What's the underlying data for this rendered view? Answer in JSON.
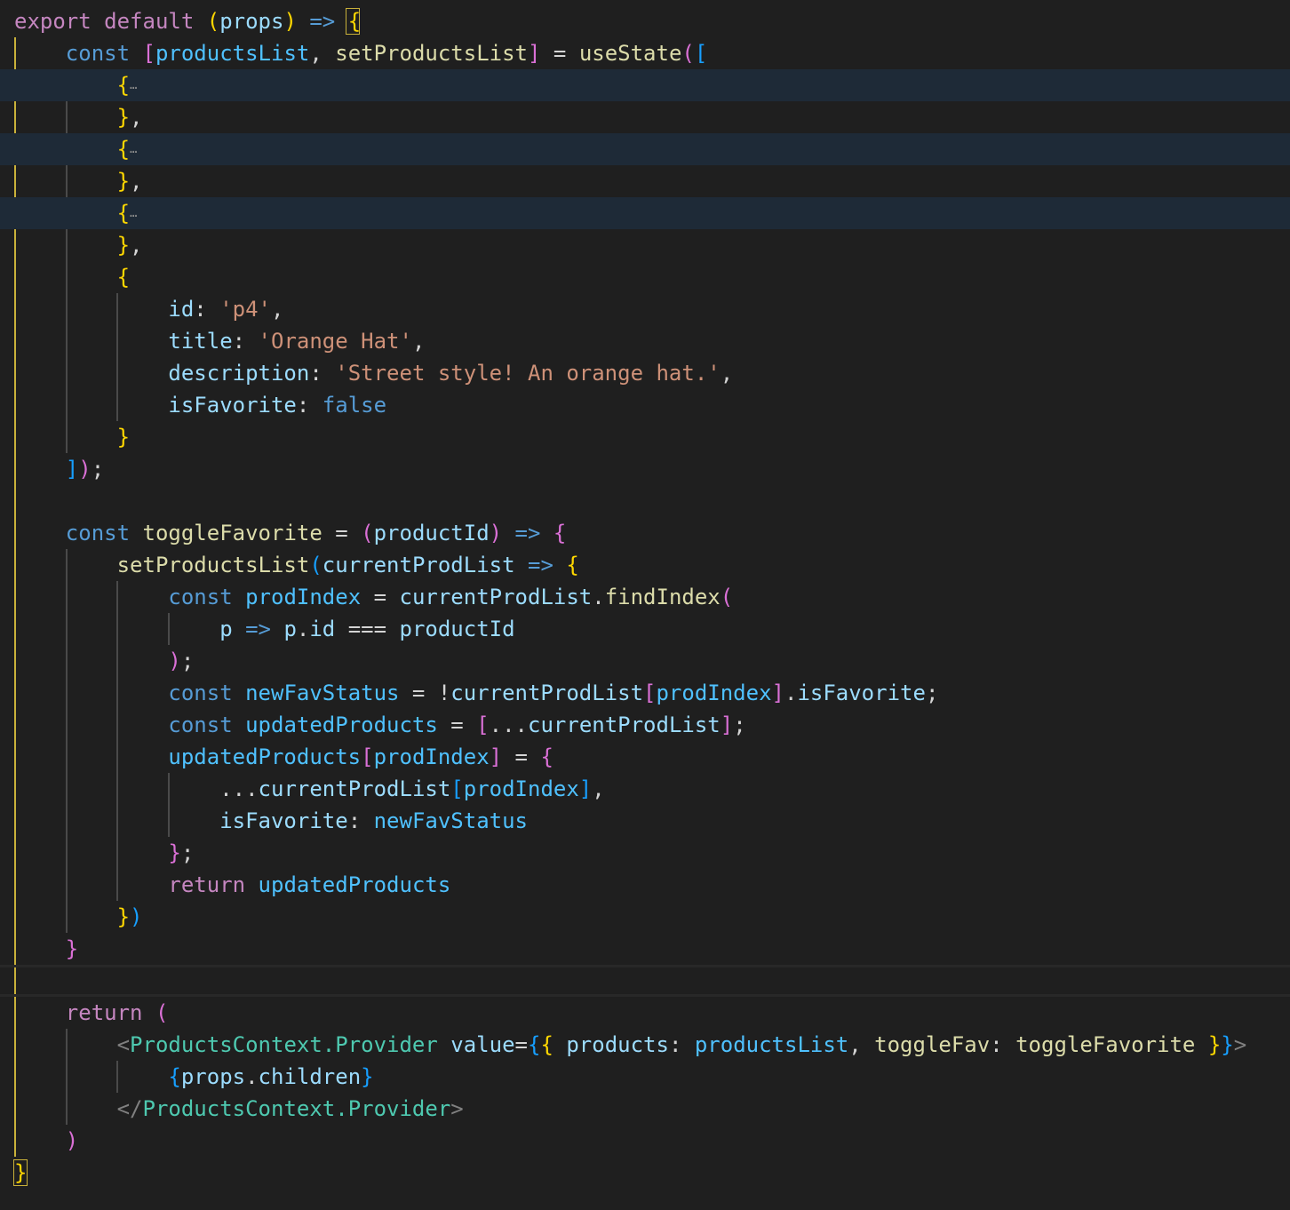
{
  "editor": {
    "lines": [
      [
        [
          "ctl",
          "export default "
        ],
        [
          "b1",
          "("
        ],
        [
          "prm",
          "props"
        ],
        [
          "b1",
          ")"
        ],
        [
          "kw",
          " => "
        ],
        [
          "b1",
          "{"
        ]
      ],
      [
        [
          "pun",
          "    "
        ],
        [
          "kw",
          "const "
        ],
        [
          "b2",
          "["
        ],
        [
          "var",
          "productsList"
        ],
        [
          "pun",
          ", "
        ],
        [
          "fn",
          "setProductsList"
        ],
        [
          "b2",
          "]"
        ],
        [
          "pun",
          " = "
        ],
        [
          "fn",
          "useState"
        ],
        [
          "b2",
          "("
        ],
        [
          "b3",
          "["
        ]
      ],
      [
        [
          "pun",
          "        "
        ],
        [
          "b1",
          "{"
        ],
        [
          "ell",
          "…"
        ]
      ],
      [
        [
          "pun",
          "        "
        ],
        [
          "b1",
          "}"
        ],
        [
          "pun",
          ","
        ]
      ],
      [
        [
          "pun",
          "        "
        ],
        [
          "b1",
          "{"
        ],
        [
          "ell",
          "…"
        ]
      ],
      [
        [
          "pun",
          "        "
        ],
        [
          "b1",
          "}"
        ],
        [
          "pun",
          ","
        ]
      ],
      [
        [
          "pun",
          "        "
        ],
        [
          "b1",
          "{"
        ],
        [
          "ell",
          "…"
        ]
      ],
      [
        [
          "pun",
          "        "
        ],
        [
          "b1",
          "}"
        ],
        [
          "pun",
          ","
        ]
      ],
      [
        [
          "pun",
          "        "
        ],
        [
          "b1",
          "{"
        ]
      ],
      [
        [
          "pun",
          "            "
        ],
        [
          "prm",
          "id"
        ],
        [
          "pun",
          ": "
        ],
        [
          "str",
          "'p4'"
        ],
        [
          "pun",
          ","
        ]
      ],
      [
        [
          "pun",
          "            "
        ],
        [
          "prm",
          "title"
        ],
        [
          "pun",
          ": "
        ],
        [
          "str",
          "'Orange Hat'"
        ],
        [
          "pun",
          ","
        ]
      ],
      [
        [
          "pun",
          "            "
        ],
        [
          "prm",
          "description"
        ],
        [
          "pun",
          ": "
        ],
        [
          "str",
          "'Street style! An orange hat.'"
        ],
        [
          "pun",
          ","
        ]
      ],
      [
        [
          "pun",
          "            "
        ],
        [
          "prm",
          "isFavorite"
        ],
        [
          "pun",
          ": "
        ],
        [
          "kw",
          "false"
        ]
      ],
      [
        [
          "pun",
          "        "
        ],
        [
          "b1",
          "}"
        ]
      ],
      [
        [
          "pun",
          "    "
        ],
        [
          "b3",
          "]"
        ],
        [
          "b2",
          ")"
        ],
        [
          "pun",
          ";"
        ]
      ],
      [],
      [
        [
          "pun",
          "    "
        ],
        [
          "kw",
          "const "
        ],
        [
          "fn",
          "toggleFavorite"
        ],
        [
          "pun",
          " = "
        ],
        [
          "b2",
          "("
        ],
        [
          "prm",
          "productId"
        ],
        [
          "b2",
          ")"
        ],
        [
          "kw",
          " => "
        ],
        [
          "b2",
          "{"
        ]
      ],
      [
        [
          "pun",
          "        "
        ],
        [
          "fn",
          "setProductsList"
        ],
        [
          "b3",
          "("
        ],
        [
          "prm",
          "currentProdList"
        ],
        [
          "kw",
          " => "
        ],
        [
          "b1",
          "{"
        ]
      ],
      [
        [
          "pun",
          "            "
        ],
        [
          "kw",
          "const "
        ],
        [
          "var",
          "prodIndex"
        ],
        [
          "pun",
          " = "
        ],
        [
          "prm",
          "currentProdList"
        ],
        [
          "pun",
          "."
        ],
        [
          "fn",
          "findIndex"
        ],
        [
          "b2",
          "("
        ]
      ],
      [
        [
          "pun",
          "                "
        ],
        [
          "prm",
          "p"
        ],
        [
          "kw",
          " => "
        ],
        [
          "prm",
          "p"
        ],
        [
          "pun",
          "."
        ],
        [
          "prm",
          "id"
        ],
        [
          "pun",
          " === "
        ],
        [
          "prm",
          "productId"
        ]
      ],
      [
        [
          "pun",
          "            "
        ],
        [
          "b2",
          ")"
        ],
        [
          "pun",
          ";"
        ]
      ],
      [
        [
          "pun",
          "            "
        ],
        [
          "kw",
          "const "
        ],
        [
          "var",
          "newFavStatus"
        ],
        [
          "pun",
          " = !"
        ],
        [
          "prm",
          "currentProdList"
        ],
        [
          "b2",
          "["
        ],
        [
          "var",
          "prodIndex"
        ],
        [
          "b2",
          "]"
        ],
        [
          "pun",
          "."
        ],
        [
          "prm",
          "isFavorite"
        ],
        [
          "pun",
          ";"
        ]
      ],
      [
        [
          "pun",
          "            "
        ],
        [
          "kw",
          "const "
        ],
        [
          "var",
          "updatedProducts"
        ],
        [
          "pun",
          " = "
        ],
        [
          "b2",
          "["
        ],
        [
          "pun",
          "..."
        ],
        [
          "prm",
          "currentProdList"
        ],
        [
          "b2",
          "]"
        ],
        [
          "pun",
          ";"
        ]
      ],
      [
        [
          "pun",
          "            "
        ],
        [
          "var",
          "updatedProducts"
        ],
        [
          "b2",
          "["
        ],
        [
          "var",
          "prodIndex"
        ],
        [
          "b2",
          "]"
        ],
        [
          "pun",
          " = "
        ],
        [
          "b2",
          "{"
        ]
      ],
      [
        [
          "pun",
          "                ..."
        ],
        [
          "prm",
          "currentProdList"
        ],
        [
          "b3",
          "["
        ],
        [
          "var",
          "prodIndex"
        ],
        [
          "b3",
          "]"
        ],
        [
          "pun",
          ","
        ]
      ],
      [
        [
          "pun",
          "                "
        ],
        [
          "prm",
          "isFavorite"
        ],
        [
          "pun",
          ": "
        ],
        [
          "var",
          "newFavStatus"
        ]
      ],
      [
        [
          "pun",
          "            "
        ],
        [
          "b2",
          "}"
        ],
        [
          "pun",
          ";"
        ]
      ],
      [
        [
          "pun",
          "            "
        ],
        [
          "ctl",
          "return "
        ],
        [
          "var",
          "updatedProducts"
        ]
      ],
      [
        [
          "pun",
          "        "
        ],
        [
          "b1",
          "}"
        ],
        [
          "b3",
          ")"
        ]
      ],
      [
        [
          "pun",
          "    "
        ],
        [
          "b2",
          "}"
        ]
      ],
      [],
      [
        [
          "pun",
          "    "
        ],
        [
          "ctl",
          "return "
        ],
        [
          "b2",
          "("
        ]
      ],
      [
        [
          "pun",
          "        "
        ],
        [
          "ang",
          "<"
        ],
        [
          "tag",
          "ProductsContext.Provider"
        ],
        [
          "pun",
          " "
        ],
        [
          "prm",
          "value"
        ],
        [
          "pun",
          "="
        ],
        [
          "b3",
          "{"
        ],
        [
          "b1",
          "{"
        ],
        [
          "pun",
          " "
        ],
        [
          "prm",
          "products"
        ],
        [
          "pun",
          ": "
        ],
        [
          "var",
          "productsList"
        ],
        [
          "pun",
          ", "
        ],
        [
          "fn",
          "toggleFav"
        ],
        [
          "pun",
          ": "
        ],
        [
          "fn",
          "toggleFavorite"
        ],
        [
          "pun",
          " "
        ],
        [
          "b1",
          "}"
        ],
        [
          "b3",
          "}"
        ],
        [
          "ang",
          ">"
        ]
      ],
      [
        [
          "pun",
          "            "
        ],
        [
          "b3",
          "{"
        ],
        [
          "prm",
          "props"
        ],
        [
          "pun",
          "."
        ],
        [
          "prm",
          "children"
        ],
        [
          "b3",
          "}"
        ]
      ],
      [
        [
          "pun",
          "        "
        ],
        [
          "ang",
          "</"
        ],
        [
          "tag",
          "ProductsContext.Provider"
        ],
        [
          "ang",
          ">"
        ]
      ],
      [
        [
          "pun",
          "    "
        ],
        [
          "b2",
          ")"
        ]
      ],
      [
        [
          "b1",
          "}"
        ]
      ]
    ]
  }
}
